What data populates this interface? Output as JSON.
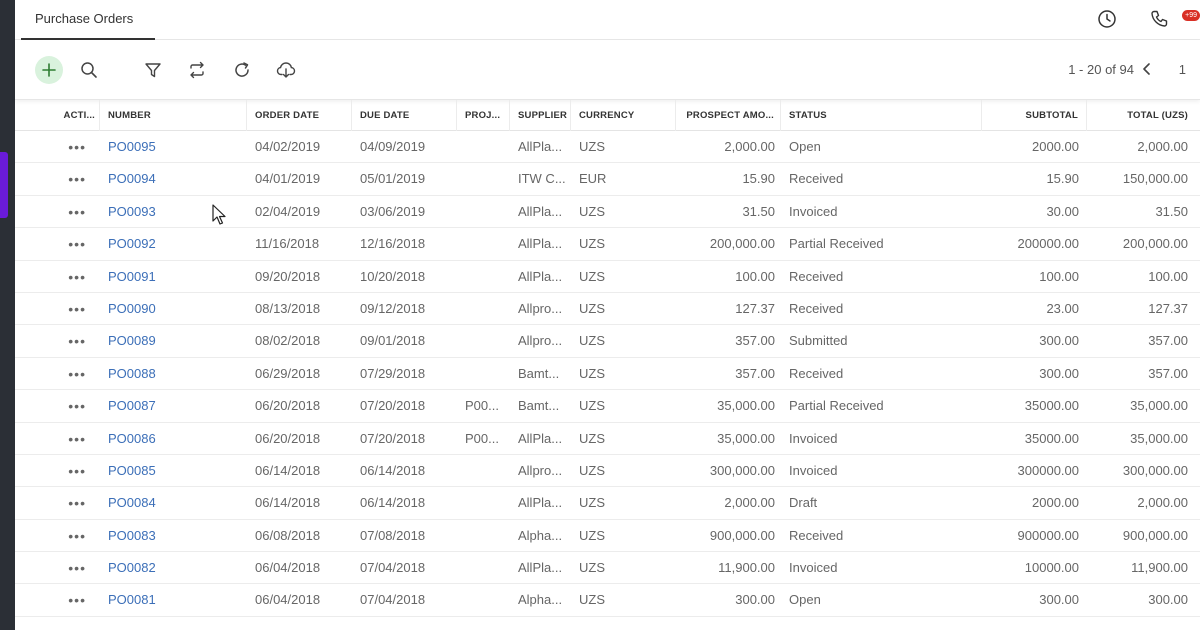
{
  "tabs": [
    {
      "label": "Purchase Orders"
    }
  ],
  "notifications": {
    "badge": "+99"
  },
  "pager": {
    "range": "1 - 20 of 94",
    "page": "1"
  },
  "columns": {
    "actions": "ACTI...",
    "number": "NUMBER",
    "order_date": "ORDER DATE",
    "due_date": "DUE DATE",
    "project": "PROJ...",
    "supplier": "SUPPLIER",
    "currency": "CURRENCY",
    "prospect_amount": "PROSPECT AMO...",
    "status": "STATUS",
    "subtotal": "SUBTOTAL",
    "total": "TOTAL (UZS)"
  },
  "rows": [
    {
      "actions": "•••",
      "number": "PO0095",
      "order_date": "04/02/2019",
      "due_date": "04/09/2019",
      "project": "",
      "supplier": "AllPla...",
      "currency": "UZS",
      "prospect": "2,000.00",
      "status": "Open",
      "subtotal": "2000.00",
      "total": "2,000.00"
    },
    {
      "actions": "•••",
      "number": "PO0094",
      "order_date": "04/01/2019",
      "due_date": "05/01/2019",
      "project": "",
      "supplier": "ITW C...",
      "currency": "EUR",
      "prospect": "15.90",
      "status": "Received",
      "subtotal": "15.90",
      "total": "150,000.00"
    },
    {
      "actions": "•••",
      "number": "PO0093",
      "order_date": "02/04/2019",
      "due_date": "03/06/2019",
      "project": "",
      "supplier": "AllPla...",
      "currency": "UZS",
      "prospect": "31.50",
      "status": "Invoiced",
      "subtotal": "30.00",
      "total": "31.50"
    },
    {
      "actions": "•••",
      "number": "PO0092",
      "order_date": "11/16/2018",
      "due_date": "12/16/2018",
      "project": "",
      "supplier": "AllPla...",
      "currency": "UZS",
      "prospect": "200,000.00",
      "status": "Partial Received",
      "subtotal": "200000.00",
      "total": "200,000.00"
    },
    {
      "actions": "•••",
      "number": "PO0091",
      "order_date": "09/20/2018",
      "due_date": "10/20/2018",
      "project": "",
      "supplier": "AllPla...",
      "currency": "UZS",
      "prospect": "100.00",
      "status": "Received",
      "subtotal": "100.00",
      "total": "100.00"
    },
    {
      "actions": "•••",
      "number": "PO0090",
      "order_date": "08/13/2018",
      "due_date": "09/12/2018",
      "project": "",
      "supplier": "Allpro...",
      "currency": "UZS",
      "prospect": "127.37",
      "status": "Received",
      "subtotal": "23.00",
      "total": "127.37"
    },
    {
      "actions": "•••",
      "number": "PO0089",
      "order_date": "08/02/2018",
      "due_date": "09/01/2018",
      "project": "",
      "supplier": "Allpro...",
      "currency": "UZS",
      "prospect": "357.00",
      "status": "Submitted",
      "subtotal": "300.00",
      "total": "357.00"
    },
    {
      "actions": "•••",
      "number": "PO0088",
      "order_date": "06/29/2018",
      "due_date": "07/29/2018",
      "project": "",
      "supplier": "Bamt...",
      "currency": "UZS",
      "prospect": "357.00",
      "status": "Received",
      "subtotal": "300.00",
      "total": "357.00"
    },
    {
      "actions": "•••",
      "number": "PO0087",
      "order_date": "06/20/2018",
      "due_date": "07/20/2018",
      "project": "P00...",
      "supplier": "Bamt...",
      "currency": "UZS",
      "prospect": "35,000.00",
      "status": "Partial Received",
      "subtotal": "35000.00",
      "total": "35,000.00"
    },
    {
      "actions": "•••",
      "number": "PO0086",
      "order_date": "06/20/2018",
      "due_date": "07/20/2018",
      "project": "P00...",
      "supplier": "AllPla...",
      "currency": "UZS",
      "prospect": "35,000.00",
      "status": "Invoiced",
      "subtotal": "35000.00",
      "total": "35,000.00"
    },
    {
      "actions": "•••",
      "number": "PO0085",
      "order_date": "06/14/2018",
      "due_date": "06/14/2018",
      "project": "",
      "supplier": "Allpro...",
      "currency": "UZS",
      "prospect": "300,000.00",
      "status": "Invoiced",
      "subtotal": "300000.00",
      "total": "300,000.00"
    },
    {
      "actions": "•••",
      "number": "PO0084",
      "order_date": "06/14/2018",
      "due_date": "06/14/2018",
      "project": "",
      "supplier": "AllPla...",
      "currency": "UZS",
      "prospect": "2,000.00",
      "status": "Draft",
      "subtotal": "2000.00",
      "total": "2,000.00"
    },
    {
      "actions": "•••",
      "number": "PO0083",
      "order_date": "06/08/2018",
      "due_date": "07/08/2018",
      "project": "",
      "supplier": "Alpha...",
      "currency": "UZS",
      "prospect": "900,000.00",
      "status": "Received",
      "subtotal": "900000.00",
      "total": "900,000.00"
    },
    {
      "actions": "•••",
      "number": "PO0082",
      "order_date": "06/04/2018",
      "due_date": "07/04/2018",
      "project": "",
      "supplier": "AllPla...",
      "currency": "UZS",
      "prospect": "11,900.00",
      "status": "Invoiced",
      "subtotal": "10000.00",
      "total": "11,900.00"
    },
    {
      "actions": "•••",
      "number": "PO0081",
      "order_date": "06/04/2018",
      "due_date": "07/04/2018",
      "project": "",
      "supplier": "Alpha...",
      "currency": "UZS",
      "prospect": "300.00",
      "status": "Open",
      "subtotal": "300.00",
      "total": "300.00"
    }
  ]
}
